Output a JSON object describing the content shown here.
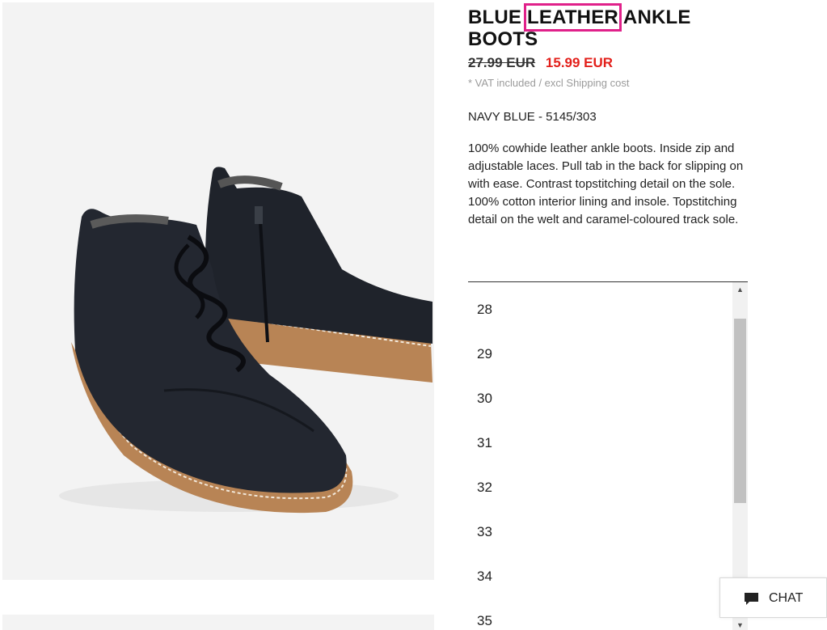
{
  "product": {
    "title_part1": "BLUE ",
    "title_highlight": "LEATHER",
    "title_part2": " ANKLE BOOTS",
    "old_price": "27.99 EUR",
    "new_price": "15.99 EUR",
    "vat_note": "* VAT included / excl Shipping cost",
    "colour_ref": "NAVY BLUE - 5145/303",
    "description": "100% cowhide leather ankle boots. Inside zip and adjustable laces. Pull tab in the back for slipping on with ease. Contrast topstitching detail on the sole. 100% cotton interior lining and insole. Topstitching detail on the welt and caramel-coloured track sole."
  },
  "sizes": [
    "28",
    "29",
    "30",
    "31",
    "32",
    "33",
    "34",
    "35"
  ],
  "chat": {
    "label": "CHAT",
    "icon": "chat-bubble-icon"
  },
  "colors": {
    "sale_price": "#e3201b",
    "highlight_box": "#e0218a",
    "image_bg": "#f3f3f3"
  }
}
